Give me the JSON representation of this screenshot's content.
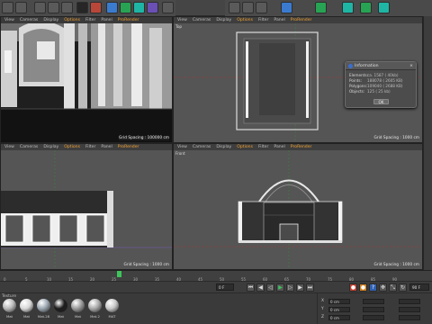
{
  "viewports": {
    "top_left": {
      "menu": [
        "View",
        "Cameras",
        "Display",
        "Options",
        "Filter",
        "Panel",
        "ProRender"
      ],
      "grid_label": "Grid Spacing : 100000 cm"
    },
    "top_right": {
      "menu": [
        "View",
        "Cameras",
        "Display",
        "Options",
        "Filter",
        "Panel",
        "ProRender"
      ],
      "title": "Top",
      "grid_label": "Grid Spacing : 1000 cm"
    },
    "bottom_left": {
      "menu": [
        "View",
        "Cameras",
        "Display",
        "Options",
        "Filter",
        "Panel",
        "ProRender"
      ],
      "grid_label": "Grid Spacing : 1000 cm"
    },
    "bottom_right": {
      "menu": [
        "View",
        "Cameras",
        "Display",
        "Options",
        "Filter",
        "Panel",
        "ProRender"
      ],
      "title": "Front",
      "grid_label": "Grid Spacing : 1000 cm"
    }
  },
  "info_dialog": {
    "title": "Information",
    "rows": [
      {
        "key": "Elements:",
        "value": "ca. 1587 ( 40kb)"
      },
      {
        "key": "Points:",
        "value": "188078 ( 2605 KB)"
      },
      {
        "key": "Polygons:",
        "value": "109040 ( 2688 KB)"
      },
      {
        "key": "Objects:",
        "value": "125 ( 25 kb)"
      }
    ],
    "ok_label": "OK"
  },
  "timeline": {
    "ticks": [
      "0",
      "5",
      "10",
      "15",
      "20",
      "25",
      "30",
      "35",
      "40",
      "45",
      "50",
      "55",
      "60",
      "65",
      "70",
      "75",
      "80",
      "85",
      "90"
    ],
    "frame_end": "0 F",
    "current_frame": "90 F"
  },
  "materials": {
    "menu": "Texture",
    "items": [
      {
        "label": "Mat",
        "color": "#b9b9b9"
      },
      {
        "label": "Mat",
        "color": "#d8d8d8"
      },
      {
        "label": "Mat.28",
        "color": "#9aa6b0"
      },
      {
        "label": "Mat",
        "color": "#1d1d1d"
      },
      {
        "label": "Mat",
        "color": "#9b9b9b"
      },
      {
        "label": "Mat.2",
        "color": "#a9a9a9"
      },
      {
        "label": "MAT",
        "color": "#c7c7c7"
      }
    ]
  },
  "coords": {
    "rows": [
      {
        "axis": "X",
        "value": "0 cm"
      },
      {
        "axis": "Y",
        "value": "0 cm"
      },
      {
        "axis": "Z",
        "value": "0 cm"
      }
    ]
  }
}
